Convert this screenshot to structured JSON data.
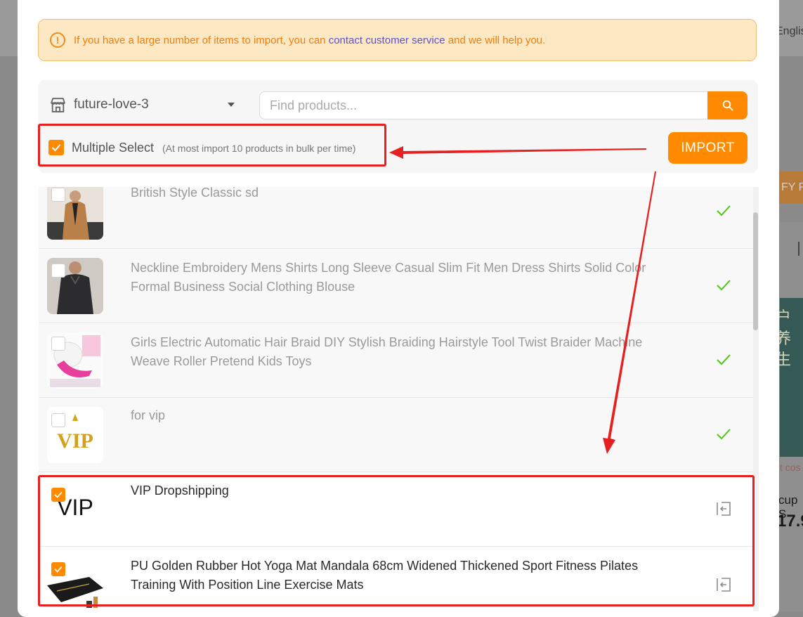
{
  "background": {
    "lang_label": "Englis",
    "orange_button_label": "FY P",
    "image_text_line1": "户",
    "image_text_line2": "养生",
    "cost_label": "t cos",
    "cup_label": "cup S",
    "price_label": "17.9"
  },
  "notice": {
    "icon_glyph": "!",
    "text_before": "If you have a large number of items to import, you can ",
    "link_text": "contact customer service",
    "text_after": " and we will help you."
  },
  "toolbar": {
    "store_name": "future-love-3",
    "search_placeholder": "Find products...",
    "multiple_select_label": "Multiple Select",
    "multiple_select_note": "(At most import 10 products in bulk per time)",
    "multiple_select_checked": true,
    "import_label": "IMPORT"
  },
  "products": [
    {
      "title": "British Style Classic sd",
      "checked": false,
      "imported": true,
      "thumb": "jacket"
    },
    {
      "title_line1": "Neckline Embroidery Mens Shirts Long Sleeve Casual Slim Fit Men Dress Shirts Solid Color",
      "title_line2": "Formal Business Social Clothing Blouse",
      "checked": false,
      "imported": true,
      "thumb": "shirt"
    },
    {
      "title_line1": "Girls Electric Automatic Hair Braid DIY Stylish Braiding Hairstyle Tool Twist Braider Machine",
      "title_line2": "Weave Roller Pretend Kids Toys",
      "checked": false,
      "imported": true,
      "thumb": "braider"
    },
    {
      "title": "for vip",
      "checked": false,
      "imported": true,
      "thumb": "vip-gold",
      "thumb_text": "VIP"
    },
    {
      "title": "VIP Dropshipping",
      "checked": true,
      "imported": false,
      "thumb": "vip-text",
      "thumb_text": "VIP"
    },
    {
      "title_line1": "PU Golden Rubber Hot Yoga Mat Mandala 68cm Widened Thickened Sport Fitness Pilates",
      "title_line2": "Training With Position Line Exercise Mats",
      "checked": true,
      "imported": false,
      "thumb": "yoga-mat"
    }
  ],
  "colors": {
    "accent": "#ff8a00",
    "annotation_red": "#e61f1f",
    "imported_green": "#52c41a",
    "link": "#5b4fd6"
  }
}
